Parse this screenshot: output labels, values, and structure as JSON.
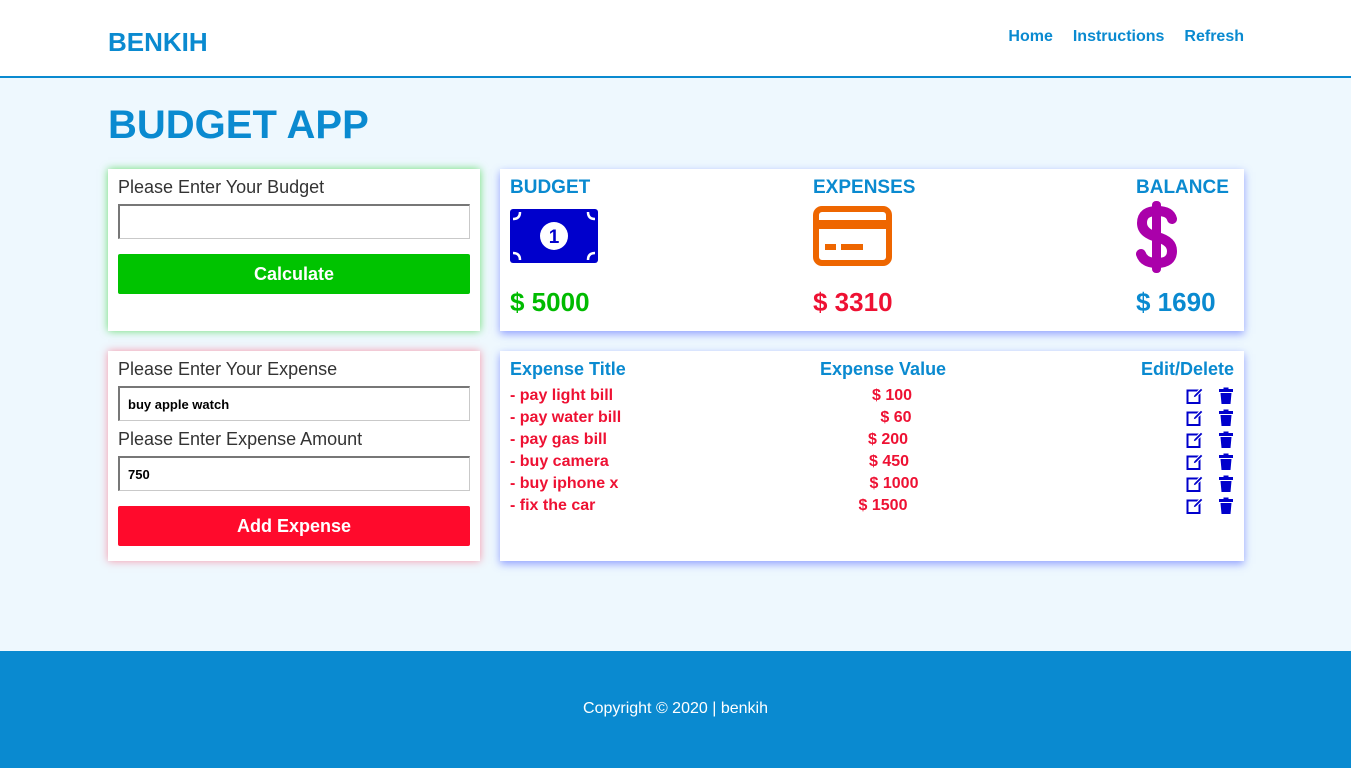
{
  "header": {
    "brand": "BENKIH",
    "nav": [
      "Home",
      "Instructions",
      "Refresh"
    ]
  },
  "page_title": "BUDGET APP",
  "budget_form": {
    "label": "Please Enter Your Budget",
    "value": "",
    "button": "Calculate"
  },
  "expense_form": {
    "title_label": "Please Enter Your Expense",
    "title_value": "buy apple watch",
    "amount_label": "Please Enter Expense Amount",
    "amount_value": "750",
    "button": "Add Expense"
  },
  "summary": {
    "budget": {
      "label": "BUDGET",
      "value": "$ 5000",
      "icon": "money-bill-icon",
      "color": "#00bb00"
    },
    "expenses": {
      "label": "EXPENSES",
      "value": "$ 3310",
      "icon": "credit-card-icon",
      "color": "#ee1133"
    },
    "balance": {
      "label": "BALANCE",
      "value": "$ 1690",
      "icon": "dollar-sign-icon",
      "color": "#0a8ad0"
    }
  },
  "list": {
    "headers": [
      "Expense Title",
      "Expense Value",
      "Edit/Delete"
    ],
    "rows": [
      {
        "title": "- pay light bill",
        "value": "$ 100"
      },
      {
        "title": "- pay water bill",
        "value": "$ 60"
      },
      {
        "title": "- pay gas bill",
        "value": "$ 200"
      },
      {
        "title": "- buy camera",
        "value": "$ 450"
      },
      {
        "title": "- buy iphone x",
        "value": "$ 1000"
      },
      {
        "title": "- fix the car",
        "value": "$ 1500"
      }
    ]
  },
  "footer": "Copyright © 2020 | benkih",
  "colors": {
    "accent": "#0a8ad0",
    "calculate": "#00c300",
    "add_expense": "#ff0a2c",
    "icons": "#0000cc",
    "credit_card": "#ee6600",
    "dollar": "#aa00aa"
  }
}
